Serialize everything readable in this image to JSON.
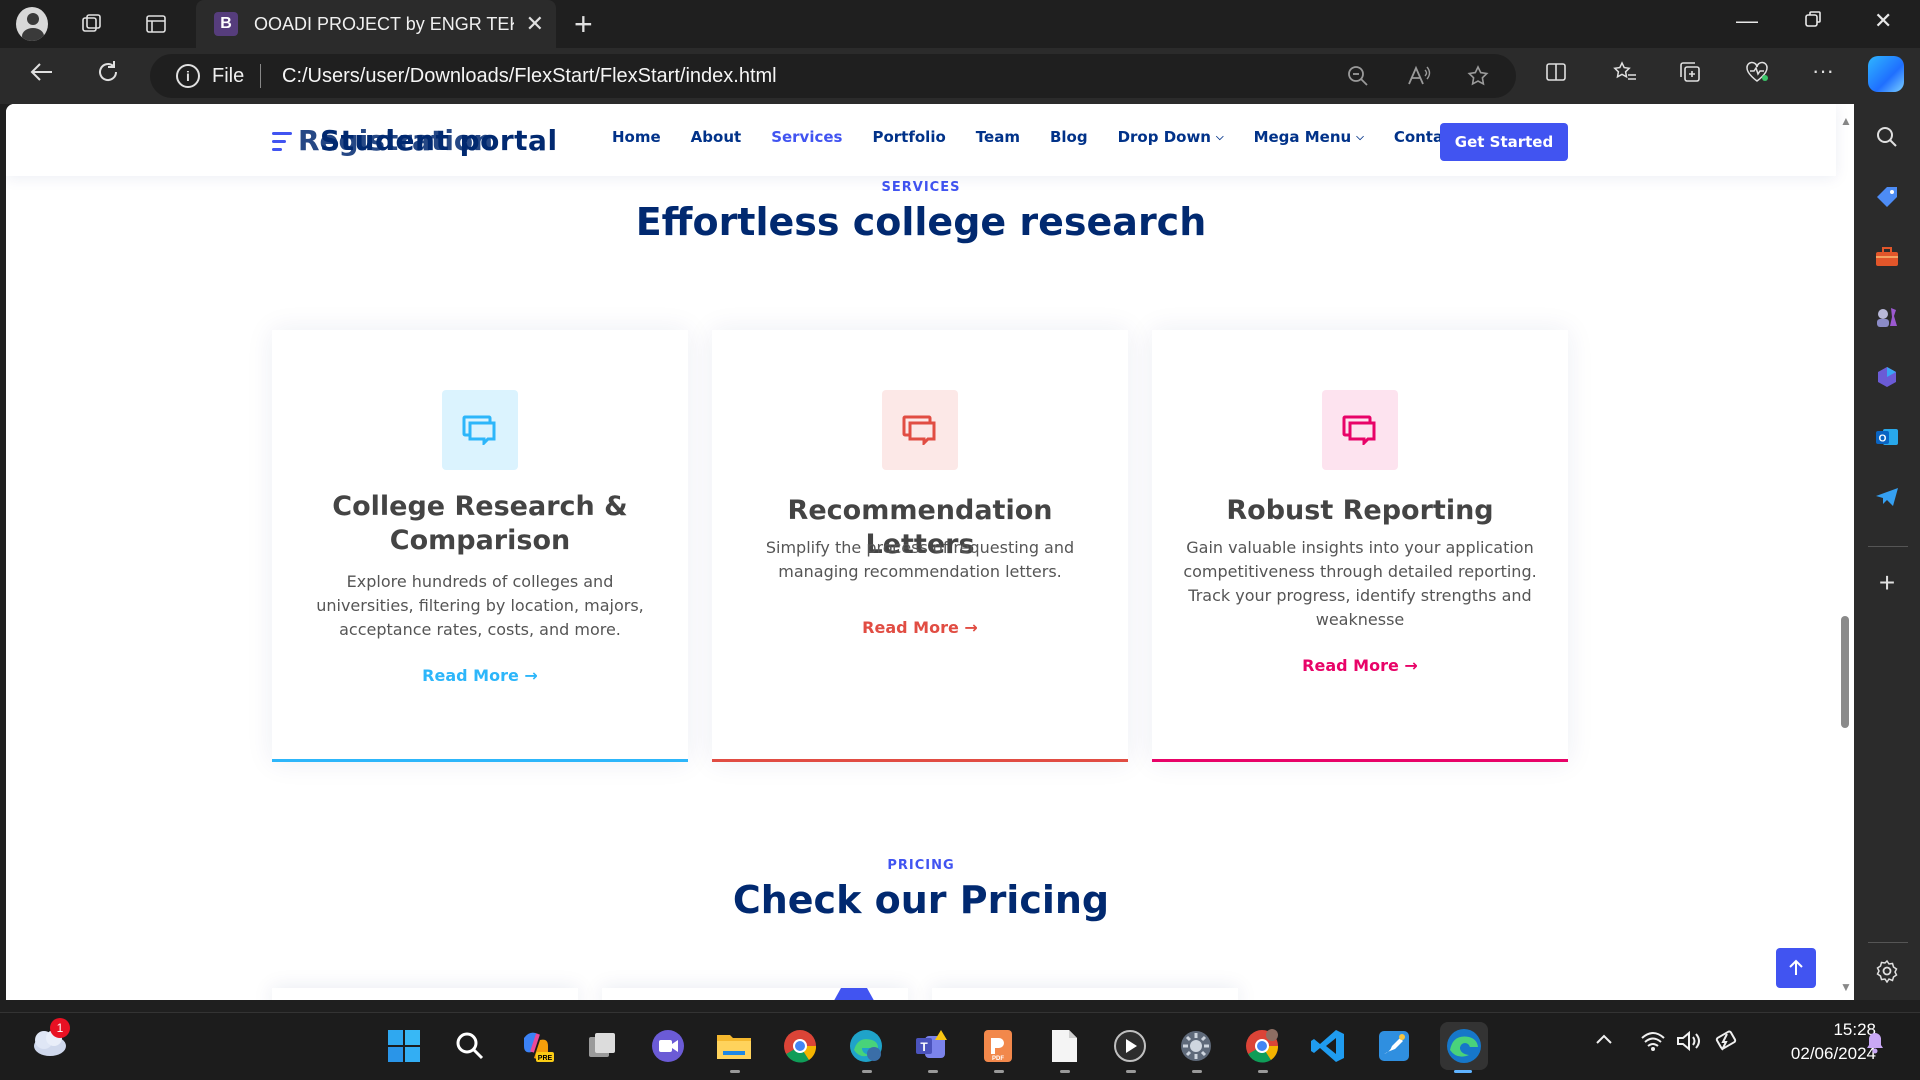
{
  "browser": {
    "tab_title": "OOADI PROJECT by ENGR TEKO",
    "tab_favicon_letter": "B",
    "url_scheme": "File",
    "url": "C:/Users/user/Downloads/FlexStart/FlexStart/index.html"
  },
  "site": {
    "logo_text": "Student portal",
    "logo_overlap_text": "Registration",
    "nav": [
      {
        "label": "Home"
      },
      {
        "label": "About"
      },
      {
        "label": "Services"
      },
      {
        "label": "Portfolio"
      },
      {
        "label": "Team"
      },
      {
        "label": "Blog"
      },
      {
        "label": "Drop Down"
      },
      {
        "label": "Mega Menu"
      },
      {
        "label": "Contact"
      }
    ],
    "cta": "Get Started"
  },
  "services": {
    "label": "SERVICES",
    "title": "Effortless college research",
    "cards": [
      {
        "title": "College Research & Comparison",
        "text": "Explore hundreds of colleges and universities, filtering by location, majors, acceptance rates, costs, and more.",
        "link": "Read More",
        "color": "#2db6fa",
        "icon_bg": "#dbf3fe"
      },
      {
        "title": "Recommendation Letters",
        "text": "Simplify the process of requesting and managing recommendation letters.",
        "link": "Read More",
        "color": "#e14d43",
        "icon_bg": "#fce8e7"
      },
      {
        "title": "Robust Reporting",
        "text": "Gain valuable insights into your application competitiveness through detailed reporting. Track your progress, identify strengths and weaknesse",
        "link": "Read More",
        "color": "#e80368",
        "icon_bg": "#fde3ef"
      }
    ]
  },
  "pricing": {
    "label": "PRICING",
    "title": "Check our Pricing"
  },
  "taskbar": {
    "weather_badge": "1",
    "time": "15:28",
    "date": "02/06/2024"
  }
}
